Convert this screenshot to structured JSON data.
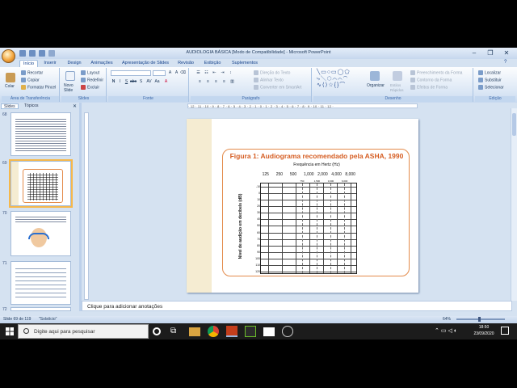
{
  "window": {
    "title": "AUDIOLOGIA BÁSICA [Modo de Compatibilidade] - Microsoft PowerPoint",
    "controls": {
      "minimize": "–",
      "maximize": "❐",
      "close": "✕"
    }
  },
  "ribbon_tabs": [
    "Início",
    "Inserir",
    "Design",
    "Animações",
    "Apresentação de Slides",
    "Revisão",
    "Exibição",
    "Suplementos"
  ],
  "active_tab": "Início",
  "ribbon": {
    "clipboard": {
      "paste": "Colar",
      "cut": "Recortar",
      "copy": "Copiar",
      "format_painter": "Formatar Pincel",
      "label": "Área de Transferência"
    },
    "slides": {
      "new_slide": "Novo Slide",
      "layout": "Layout",
      "reset": "Redefinir",
      "delete": "Excluir",
      "label": "Slides"
    },
    "font": {
      "label": "Fonte"
    },
    "paragraph": {
      "text_direction": "Direção do Texto",
      "align_text": "Alinhar Texto",
      "smartart": "Converter em SmartArt",
      "label": "Parágrafo"
    },
    "drawing": {
      "arrange": "Organizar",
      "quick_styles": "Estilos Rápidos",
      "shape_fill": "Preenchimento da Forma",
      "shape_outline": "Contorno da Forma",
      "shape_effects": "Efeitos de Forma",
      "label": "Desenho"
    },
    "editing": {
      "find": "Localizar",
      "replace": "Substituir",
      "select": "Selecionar",
      "label": "Edição"
    }
  },
  "left_panel": {
    "tabs": [
      "Slides",
      "Tópicos"
    ],
    "slide_numbers": [
      "68",
      "69",
      "70",
      "71",
      "72"
    ]
  },
  "slide": {
    "figure_title": "Figura 1: Audiograma recomendado pela ASHA, 1990",
    "x_axis_label": "Frequência em Hertz (Hz)",
    "frequencies": [
      "125",
      "250",
      "500",
      "1,000",
      "2,000",
      "4,000",
      "8,000"
    ],
    "sub_frequencies": [
      "750",
      "1,500",
      "3,000",
      "6,000"
    ],
    "y_axis_label": "Nível de audição em decibels (dB)",
    "db_levels": [
      "-10",
      "0",
      "10",
      "20",
      "30",
      "40",
      "50",
      "60",
      "70",
      "80",
      "90",
      "100",
      "110",
      "120"
    ]
  },
  "notes_placeholder": "Clique para adicionar anotações",
  "status": {
    "slide_info": "Slide 69 de 119",
    "theme": "\"Solstício\"",
    "zoom": "64%"
  },
  "taskbar": {
    "search_placeholder": "Digite aqui para pesquisar",
    "time": "18:50",
    "date": "23/09/2020"
  }
}
